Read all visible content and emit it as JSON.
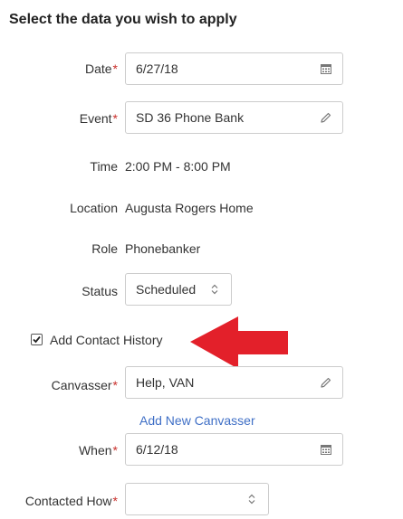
{
  "heading": "Select the data you wish to apply",
  "date": {
    "label": "Date",
    "value": "6/27/18",
    "icon": "calendar-icon"
  },
  "event": {
    "label": "Event",
    "value": "SD 36 Phone Bank",
    "icon": "pencil-icon"
  },
  "time": {
    "label": "Time",
    "value": "2:00 PM - 8:00 PM"
  },
  "location": {
    "label": "Location",
    "value": "Augusta Rogers Home"
  },
  "role": {
    "label": "Role",
    "value": "Phonebanker"
  },
  "status": {
    "label": "Status",
    "value": "Scheduled",
    "icon": "updown-chevron-icon"
  },
  "contact_history": {
    "label": "Add Contact History",
    "checked": true
  },
  "canvasser": {
    "label": "Canvasser",
    "value": "Help, VAN",
    "icon": "pencil-icon",
    "add_link": "Add New Canvasser"
  },
  "when": {
    "label": "When",
    "value": "6/12/18",
    "icon": "calendar-icon"
  },
  "contacted_how": {
    "label": "Contacted How",
    "value": "",
    "icon": "updown-chevron-icon"
  },
  "required_marker": "*",
  "colors": {
    "required": "#c9302c",
    "link": "#3f6fc6",
    "arrow": "#e3202a"
  }
}
